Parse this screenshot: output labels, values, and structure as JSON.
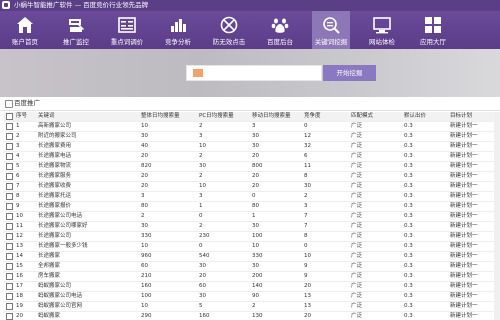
{
  "app": {
    "title": "小蜗牛智能推广软件 — 百度竞价行业领先品牌"
  },
  "nav": [
    {
      "label": "账户首页",
      "icon": "home-icon"
    },
    {
      "label": "推广监控",
      "icon": "monitor-icon"
    },
    {
      "label": "重点词调价",
      "icon": "adjust-price-icon"
    },
    {
      "label": "竞争分析",
      "icon": "bar-chart-icon"
    },
    {
      "label": "防无效点击",
      "icon": "block-click-icon"
    },
    {
      "label": "百度后台",
      "icon": "baidu-paw-icon"
    },
    {
      "label": "关键词挖掘",
      "icon": "keyword-search-icon",
      "active": true
    },
    {
      "label": "网站体检",
      "icon": "site-check-icon"
    },
    {
      "label": "应用大厅",
      "icon": "apps-grid-icon"
    }
  ],
  "search": {
    "button_label": "开始挖掘"
  },
  "section": {
    "title": "百度推广"
  },
  "table": {
    "columns": [
      "序号",
      "关键词",
      "整体日均搜索量",
      "PC日均搜索量",
      "移动日均搜索量",
      "竞争度",
      "匹配模式",
      "默认出价",
      "目标计划"
    ],
    "rows": [
      [
        "1",
        "高新搬家公司",
        "10",
        "2",
        "3",
        "0",
        "广泛",
        "0.3",
        "新建计划一"
      ],
      [
        "2",
        "附近的搬家公司",
        "30",
        "3",
        "30",
        "12",
        "广泛",
        "0.3",
        "新建计划一"
      ],
      [
        "3",
        "长途搬家费用",
        "40",
        "10",
        "30",
        "32",
        "广泛",
        "0.3",
        "新建计划一"
      ],
      [
        "4",
        "长途搬家电话",
        "20",
        "2",
        "20",
        "6",
        "广泛",
        "0.3",
        "新建计划一"
      ],
      [
        "5",
        "长途搬家物流",
        "820",
        "30",
        "800",
        "11",
        "广泛",
        "0.3",
        "新建计划一"
      ],
      [
        "6",
        "长途搬家服务",
        "20",
        "2",
        "20",
        "8",
        "广泛",
        "0.3",
        "新建计划一"
      ],
      [
        "7",
        "长途搬家收费",
        "20",
        "10",
        "20",
        "30",
        "广泛",
        "0.3",
        "新建计划一"
      ],
      [
        "8",
        "长途搬家托运",
        "3",
        "3",
        "0",
        "2",
        "广泛",
        "0.3",
        "新建计划一"
      ],
      [
        "9",
        "长途搬家报价",
        "80",
        "1",
        "80",
        "3",
        "广泛",
        "0.3",
        "新建计划一"
      ],
      [
        "10",
        "长途搬家公司电话",
        "2",
        "0",
        "1",
        "7",
        "广泛",
        "0.3",
        "新建计划一"
      ],
      [
        "11",
        "长途搬家公司哪家好",
        "30",
        "2",
        "30",
        "7",
        "广泛",
        "0.3",
        "新建计划一"
      ],
      [
        "12",
        "长途搬家公司",
        "330",
        "230",
        "100",
        "8",
        "广泛",
        "0.3",
        "新建计划一"
      ],
      [
        "13",
        "长途搬家一般多少钱",
        "10",
        "0",
        "10",
        "0",
        "广泛",
        "0.3",
        "新建计划一"
      ],
      [
        "14",
        "长途搬家",
        "960",
        "540",
        "330",
        "10",
        "广泛",
        "0.3",
        "新建计划一"
      ],
      [
        "15",
        "全邦搬家",
        "60",
        "30",
        "30",
        "9",
        "广泛",
        "0.3",
        "新建计划一"
      ],
      [
        "16",
        "房车搬家",
        "210",
        "20",
        "200",
        "9",
        "广泛",
        "0.3",
        "新建计划一"
      ],
      [
        "17",
        "蚂蚁搬家公司",
        "160",
        "60",
        "140",
        "20",
        "广泛",
        "0.3",
        "新建计划一"
      ],
      [
        "18",
        "蚂蚁搬家公司电话",
        "100",
        "30",
        "90",
        "13",
        "广泛",
        "0.3",
        "新建计划一"
      ],
      [
        "19",
        "蚂蚁搬家公司官网",
        "10",
        "5",
        "2",
        "13",
        "广泛",
        "0.3",
        "新建计划一"
      ],
      [
        "20",
        "蚂蚁搬家",
        "290",
        "160",
        "130",
        "20",
        "广泛",
        "0.3",
        "新建计划一"
      ]
    ]
  }
}
